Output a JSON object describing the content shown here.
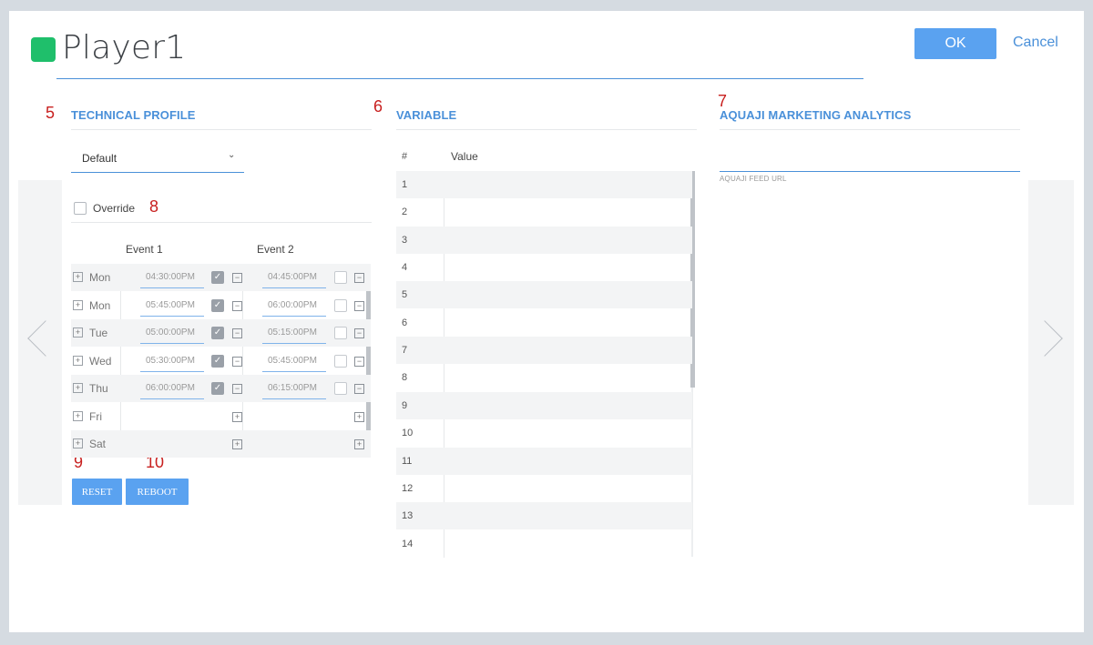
{
  "header": {
    "title": "Player1",
    "status_color": "#1fbf6b",
    "ok_label": "OK",
    "cancel_label": "Cancel"
  },
  "markers": {
    "technical_profile": "5",
    "variable": "6",
    "aquaji": "7",
    "override": "8",
    "reset": "9",
    "reboot": "10"
  },
  "technical_profile": {
    "heading": "TECHNICAL PROFILE",
    "profile_value": "Default",
    "override_label": "Override",
    "override_checked": false,
    "event1_header": "Event 1",
    "event2_header": "Event 2",
    "schedule": [
      {
        "day": "Mon",
        "event1": "04:30:00PM",
        "event1_on": true,
        "event2": "04:45:00PM",
        "event2_on": false
      },
      {
        "day": "Mon",
        "event1": "05:45:00PM",
        "event1_on": true,
        "event2": "06:00:00PM",
        "event2_on": false
      },
      {
        "day": "Tue",
        "event1": "05:00:00PM",
        "event1_on": true,
        "event2": "05:15:00PM",
        "event2_on": false
      },
      {
        "day": "Wed",
        "event1": "05:30:00PM",
        "event1_on": true,
        "event2": "05:45:00PM",
        "event2_on": false
      },
      {
        "day": "Thu",
        "event1": "06:00:00PM",
        "event1_on": true,
        "event2": "06:15:00PM",
        "event2_on": false
      },
      {
        "day": "Fri",
        "event1": "",
        "event1_on": null,
        "event2": "",
        "event2_on": null
      },
      {
        "day": "Sat",
        "event1": "",
        "event1_on": null,
        "event2": "",
        "event2_on": null
      }
    ],
    "reset_label": "RESET",
    "reboot_label": "REBOOT"
  },
  "variable": {
    "heading": "VARIABLE",
    "col_num": "#",
    "col_value": "Value",
    "rows": [
      "1",
      "2",
      "3",
      "4",
      "5",
      "6",
      "7",
      "8",
      "9",
      "10",
      "11",
      "12",
      "13",
      "14"
    ]
  },
  "aquaji": {
    "heading": "AQUAJI MARKETING ANALYTICS",
    "feed_label": "AQUAJI FEED URL",
    "feed_value": ""
  },
  "colors": {
    "accent": "#4a90d9",
    "button": "#5aa2f0",
    "marker": "#c8201f"
  }
}
